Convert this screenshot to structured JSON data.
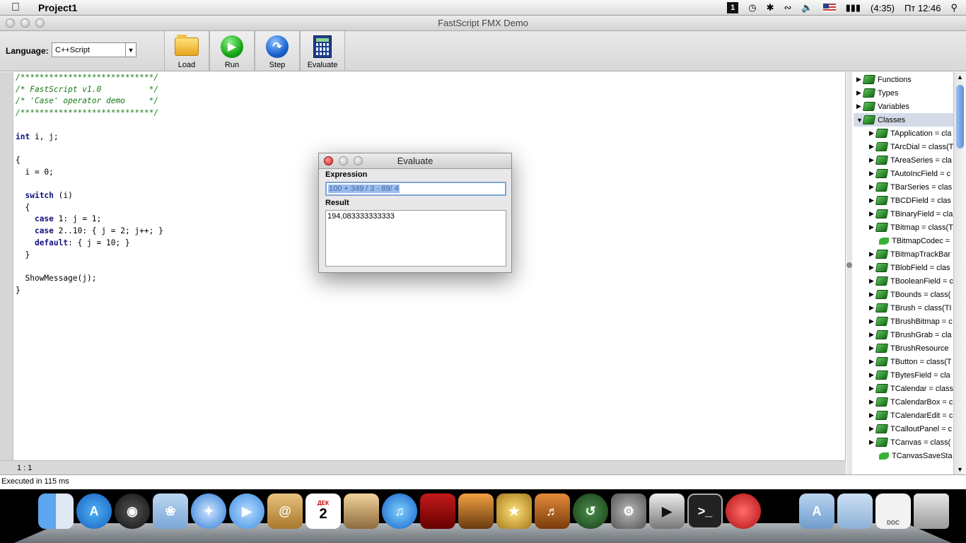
{
  "menubar": {
    "apple": "",
    "app_name": "Project1",
    "keyboard_indicator": "1",
    "battery_text": "(4:35)",
    "clock": "Пт 12:46"
  },
  "window": {
    "title": "FastScript FMX Demo",
    "language_label": "Language:",
    "language_value": "C++Script",
    "toolbar": {
      "load": "Load",
      "run": "Run",
      "step": "Step",
      "evaluate": "Evaluate"
    },
    "code_lines": [
      "/****************************/",
      "/* FastScript v1.0          */",
      "/* 'Case' operator demo     */",
      "/****************************/",
      "",
      "int i, j;",
      "",
      "{",
      "  i = 0;",
      "",
      "  switch (i)",
      "  {",
      "    case 1: j = 1;",
      "    case 2..10: { j = 2; j++; }",
      "    default: { j = 10; }",
      "  }",
      "",
      "  ShowMessage(j);",
      "}"
    ],
    "cursor_position": "1 : 1",
    "status": "Executed in 115 ms",
    "tree": {
      "roots": [
        "Functions",
        "Types",
        "Variables",
        "Classes"
      ],
      "classes": [
        "TApplication = cla",
        "TArcDial = class(T",
        "TAreaSeries = cla",
        "TAutoIncField = c",
        "TBarSeries = clas",
        "TBCDField = clas",
        "TBinaryField = cla",
        "TBitmap = class(T",
        "TBitmapCodec =",
        "TBitmapTrackBar",
        "TBlobField = clas",
        "TBooleanField = c",
        "TBounds = class(",
        "TBrush = class(TI",
        "TBrushBitmap = c",
        "TBrushGrab = cla",
        "TBrushResource",
        "TButton = class(T",
        "TBytesField = cla",
        "TCalendar = class",
        "TCalendarBox = c",
        "TCalendarEdit = c",
        "TCalloutPanel = c",
        "TCanvas = class(",
        "TCanvasSaveSta"
      ]
    }
  },
  "dialog": {
    "title": "Evaluate",
    "expression_label": "Expression",
    "expression_value": "100 + 349 / 3 - 89/ 4",
    "result_label": "Result",
    "result_value": "194,083333333333"
  },
  "dock": {
    "calendar_month": "ДЕК",
    "calendar_day": "2",
    "doc_label": "DOC"
  }
}
